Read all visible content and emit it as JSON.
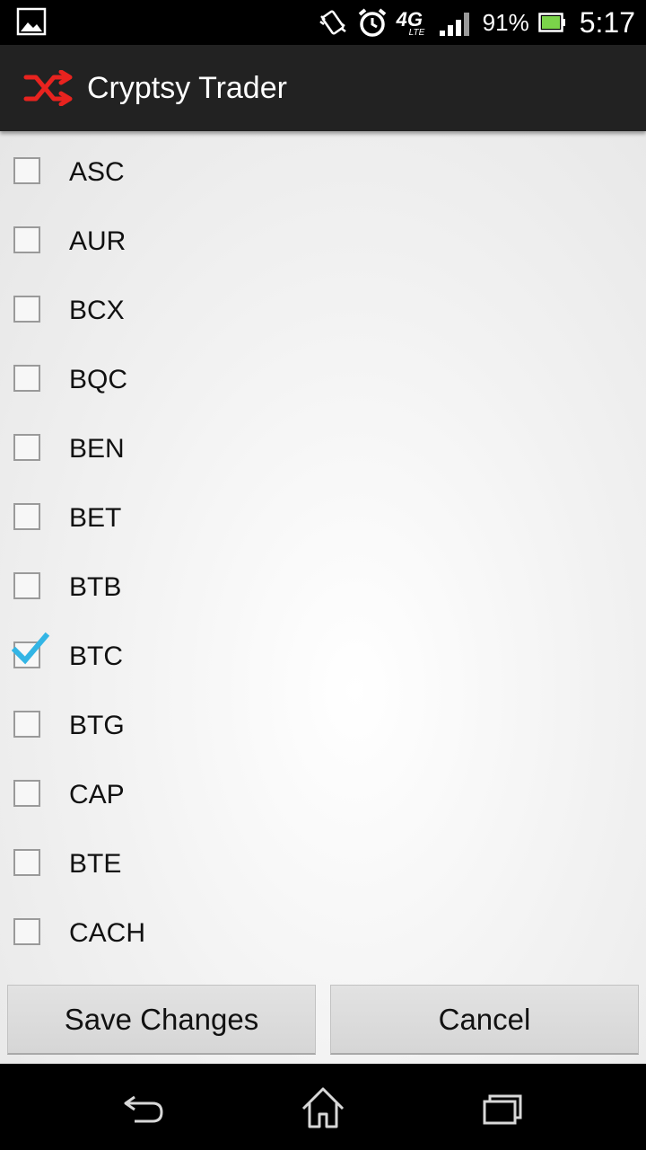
{
  "status_bar": {
    "battery_percent": "91%",
    "time": "5:17",
    "network_label": "4G",
    "network_sub": "LTE",
    "icons": [
      "image-icon",
      "vibrate-icon",
      "alarm-icon",
      "signal-icon",
      "battery-icon"
    ]
  },
  "action_bar": {
    "title": "Cryptsy Trader",
    "icon": "shuffle-icon",
    "icon_color": "#e8231f",
    "background": "#222222"
  },
  "currencies": [
    {
      "label": "ASC",
      "checked": false
    },
    {
      "label": "AUR",
      "checked": false
    },
    {
      "label": "BCX",
      "checked": false
    },
    {
      "label": "BQC",
      "checked": false
    },
    {
      "label": "BEN",
      "checked": false
    },
    {
      "label": "BET",
      "checked": false
    },
    {
      "label": "BTB",
      "checked": false
    },
    {
      "label": "BTC",
      "checked": true
    },
    {
      "label": "BTG",
      "checked": false
    },
    {
      "label": "CAP",
      "checked": false
    },
    {
      "label": "BTE",
      "checked": false
    },
    {
      "label": "CACH",
      "checked": false
    }
  ],
  "buttons": {
    "save_label": "Save Changes",
    "cancel_label": "Cancel"
  },
  "nav_bar": {
    "icons": [
      "back-icon",
      "home-icon",
      "recents-icon"
    ]
  },
  "colors": {
    "check_accent": "#33b5e5"
  }
}
